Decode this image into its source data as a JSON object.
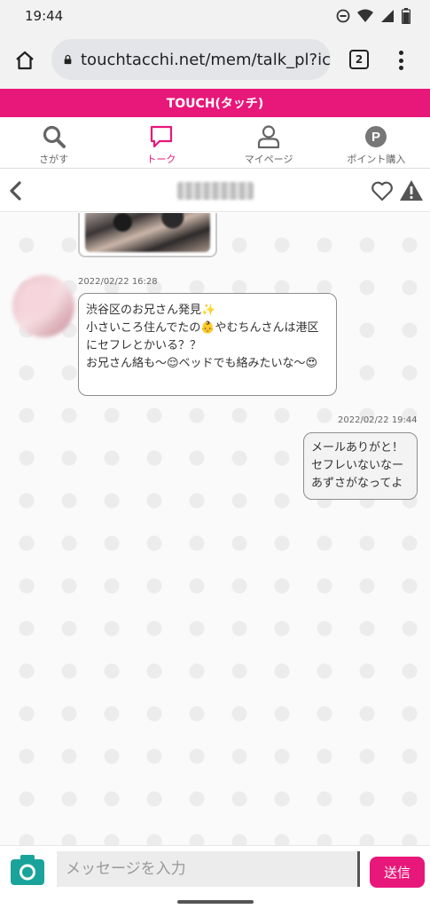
{
  "status_bar": {
    "time": "19:44"
  },
  "browser": {
    "url": "touchtacchi.net/mem/talk_pl?ic",
    "tab_count": "2"
  },
  "site": {
    "title": "TOUCH(タッチ)"
  },
  "nav": {
    "items": [
      {
        "label": "さがす",
        "icon": "search-icon"
      },
      {
        "label": "トーク",
        "icon": "chat-bubble-icon",
        "active": true
      },
      {
        "label": "マイページ",
        "icon": "person-icon"
      },
      {
        "label": "ポイント購入",
        "icon": "point-icon"
      }
    ],
    "active_color": "#e8177a"
  },
  "talk": {
    "messages": [
      {
        "side": "left",
        "timestamp": "2022/02/22 16:28",
        "text": "渋谷区のお兄さん発見✨\n小さいころ住んでたの👶やむちんさんは港区にセフレとかいる？？\nお兄さん絡も〜😌ベッドでも絡みたいな〜😍"
      },
      {
        "side": "right",
        "timestamp": "2022/02/22 19:44",
        "text": "メールありがと！\nセフレいないなー\nあずさがなってよ"
      }
    ]
  },
  "composer": {
    "placeholder": "メッセージを入力",
    "send_label": "送信"
  },
  "colors": {
    "brand": "#e8177a",
    "camera": "#1aa39a"
  }
}
